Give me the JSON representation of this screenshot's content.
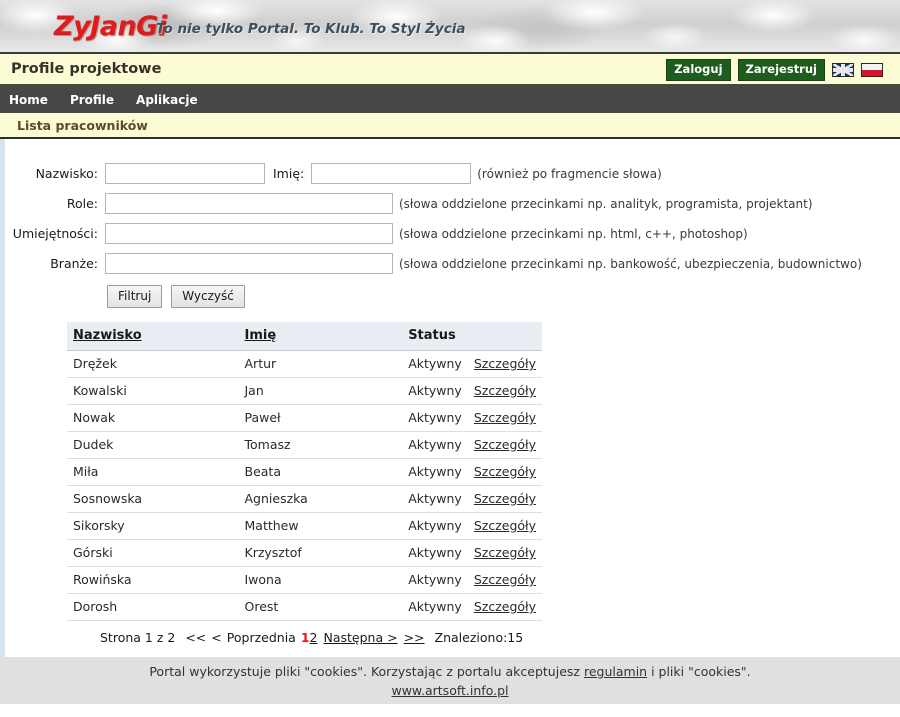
{
  "banner": {
    "logo": "ZyJanGi",
    "tagline": "To nie tylko Portal. To Klub. To Styl Życia"
  },
  "titlebar": {
    "title": "Profile projektowe",
    "login_label": "Zaloguj",
    "register_label": "Zarejestruj",
    "flags": [
      {
        "name": "uk-flag-icon",
        "alt": "English"
      },
      {
        "name": "pl-flag-icon",
        "alt": "Polski"
      }
    ]
  },
  "nav": {
    "items": [
      {
        "label": "Home"
      },
      {
        "label": "Profile"
      },
      {
        "label": "Aplikacje"
      }
    ]
  },
  "subtitle": {
    "text": "Lista pracowników"
  },
  "filter_form": {
    "fields": {
      "nazwisko": {
        "label": "Nazwisko:",
        "value": "",
        "placeholder": ""
      },
      "imie": {
        "label": "Imię:",
        "value": "",
        "placeholder": "",
        "hint": "(również po fragmencie słowa)"
      },
      "role": {
        "label": "Role:",
        "value": "",
        "placeholder": "",
        "hint": "(słowa oddzielone przecinkami np. analityk, programista, projektant)"
      },
      "umiejetnosci": {
        "label": "Umiejętności:",
        "value": "",
        "placeholder": "",
        "hint": "(słowa oddzielone przecinkami np. html, c++, photoshop)"
      },
      "branze": {
        "label": "Branże:",
        "value": "",
        "placeholder": "",
        "hint": "(słowa oddzielone przecinkami np. bankowość, ubezpieczenia, budownictwo)"
      }
    },
    "filter_button": "Filtruj",
    "clear_button": "Wyczyść"
  },
  "table": {
    "headers": {
      "nazwisko": "Nazwisko",
      "imie": "Imię",
      "status": "Status"
    },
    "details_label": "Szczegóły",
    "rows": [
      {
        "nazwisko": "Dręžek",
        "imie": "Artur",
        "status": "Aktywny"
      },
      {
        "nazwisko": "Kowalski",
        "imie": "Jan",
        "status": "Aktywny"
      },
      {
        "nazwisko": "Nowak",
        "imie": "Paweł",
        "status": "Aktywny"
      },
      {
        "nazwisko": "Dudek",
        "imie": "Tomasz",
        "status": "Aktywny"
      },
      {
        "nazwisko": "Miła",
        "imie": "Beata",
        "status": "Aktywny"
      },
      {
        "nazwisko": "Sosnowska",
        "imie": "Agnieszka",
        "status": "Aktywny"
      },
      {
        "nazwisko": "Sikorsky",
        "imie": "Matthew",
        "status": "Aktywny"
      },
      {
        "nazwisko": "Górski",
        "imie": "Krzysztof",
        "status": "Aktywny"
      },
      {
        "nazwisko": "Rowińska",
        "imie": "Iwona",
        "status": "Aktywny"
      },
      {
        "nazwisko": "Dorosh",
        "imie": "Orest",
        "status": "Aktywny"
      }
    ]
  },
  "pagination": {
    "page_text": "Strona 1 z 2",
    "first_label": "<<",
    "prev_arrow_label": "<",
    "prev_label": "Poprzednia",
    "page_current": "1",
    "page_other": "2",
    "next_label": "Następna >",
    "last_label": ">>",
    "found_label": "Znaleziono:15"
  },
  "footer": {
    "line1_before": "Portal wykorzystuje pliki \"cookies\". Korzystając z portalu akceptujesz",
    "terms_link": "regulamin",
    "line1_after": "i pliki \"cookies\".",
    "site_link": "www.artsoft.info.pl"
  },
  "colors": {
    "accent_red": "#e01b1b",
    "cream": "#fbfbd4",
    "dark_bar": "#474745",
    "green_button": "#1f5d1f",
    "table_header": "#e9eef5"
  }
}
